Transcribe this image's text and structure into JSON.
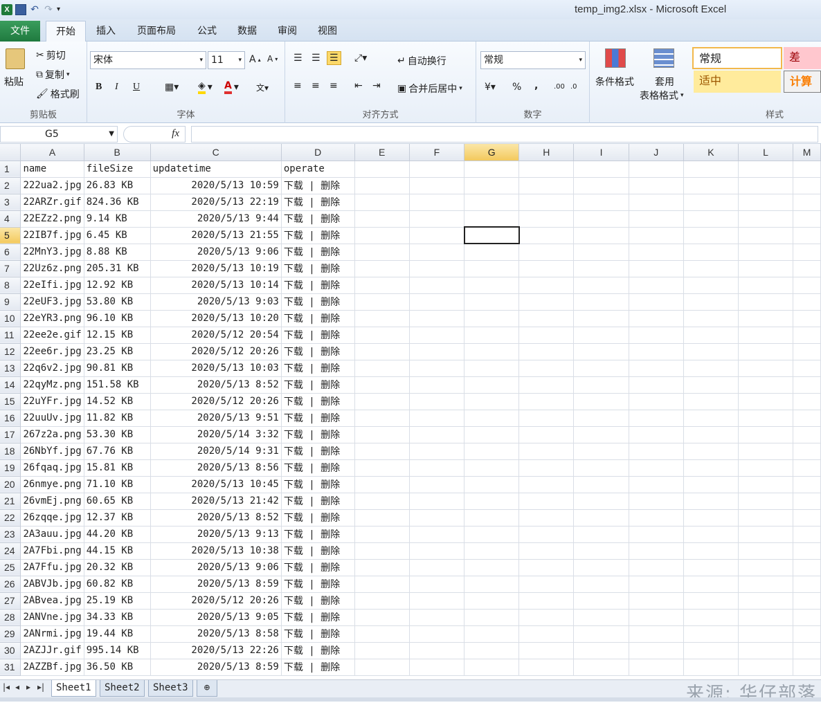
{
  "app": {
    "title": "temp_img2.xlsx - Microsoft Excel",
    "logo_letter": "X"
  },
  "tabs": [
    "文件",
    "开始",
    "插入",
    "页面布局",
    "公式",
    "数据",
    "审阅",
    "视图"
  ],
  "ribbon": {
    "clipboard": {
      "paste": "粘贴",
      "cut": "剪切",
      "copy": "复制",
      "format_painter": "格式刷",
      "label": "剪贴板"
    },
    "font": {
      "name": "宋体",
      "size": "11",
      "label": "字体",
      "bold": "B",
      "italic": "I",
      "underline": "U"
    },
    "alignment": {
      "wrap": "自动换行",
      "merge": "合并后居中",
      "label": "对齐方式"
    },
    "number": {
      "format": "常规",
      "percent": "%",
      "comma": ",",
      "label": "数字"
    },
    "styles": {
      "conditional": "条件格式",
      "table_format_1": "套用",
      "table_format_2": "表格格式",
      "normal": "常规",
      "bad": "差",
      "neutral": "适中",
      "calc": "计算",
      "label": "样式"
    }
  },
  "formula_bar": {
    "cell_ref": "G5",
    "fx": "fx",
    "value": ""
  },
  "columns": [
    "A",
    "B",
    "C",
    "D",
    "E",
    "F",
    "G",
    "H",
    "I",
    "J",
    "K",
    "L"
  ],
  "selected": {
    "col": "G",
    "row": "5"
  },
  "rows": [
    [
      "1",
      "name",
      "fileSize",
      "updatetime",
      "operate"
    ],
    [
      "2",
      "222ua2.jpg",
      "26.83 KB",
      "2020/5/13 10:59",
      "下载 | 删除"
    ],
    [
      "3",
      "22ARZr.gif",
      "824.36 KB",
      "2020/5/13 22:19",
      "下载 | 删除"
    ],
    [
      "4",
      "22EZz2.png",
      "9.14 KB",
      "2020/5/13 9:44",
      "下载 | 删除"
    ],
    [
      "5",
      "22IB7f.jpg",
      "6.45 KB",
      "2020/5/13 21:55",
      "下载 | 删除"
    ],
    [
      "6",
      "22MnY3.jpg",
      "8.88 KB",
      "2020/5/13 9:06",
      "下载 | 删除"
    ],
    [
      "7",
      "22Uz6z.png",
      "205.31 KB",
      "2020/5/13 10:19",
      "下载 | 删除"
    ],
    [
      "8",
      "22eIfi.jpg",
      "12.92 KB",
      "2020/5/13 10:14",
      "下载 | 删除"
    ],
    [
      "9",
      "22eUF3.jpg",
      "53.80 KB",
      "2020/5/13 9:03",
      "下载 | 删除"
    ],
    [
      "10",
      "22eYR3.png",
      "96.10 KB",
      "2020/5/13 10:20",
      "下载 | 删除"
    ],
    [
      "11",
      "22ee2e.gif",
      "12.15 KB",
      "2020/5/12 20:54",
      "下载 | 删除"
    ],
    [
      "12",
      "22ee6r.jpg",
      "23.25 KB",
      "2020/5/12 20:26",
      "下载 | 删除"
    ],
    [
      "13",
      "22q6v2.jpg",
      "90.81 KB",
      "2020/5/13 10:03",
      "下载 | 删除"
    ],
    [
      "14",
      "22qyMz.png",
      "151.58 KB",
      "2020/5/13 8:52",
      "下载 | 删除"
    ],
    [
      "15",
      "22uYFr.jpg",
      "14.52 KB",
      "2020/5/12 20:26",
      "下载 | 删除"
    ],
    [
      "16",
      "22uuUv.jpg",
      "11.82 KB",
      "2020/5/13 9:51",
      "下载 | 删除"
    ],
    [
      "17",
      "267z2a.png",
      "53.30 KB",
      "2020/5/14 3:32",
      "下载 | 删除"
    ],
    [
      "18",
      "26NbYf.jpg",
      "67.76 KB",
      "2020/5/14 9:31",
      "下载 | 删除"
    ],
    [
      "19",
      "26fqaq.jpg",
      "15.81 KB",
      "2020/5/13 8:56",
      "下载 | 删除"
    ],
    [
      "20",
      "26nmye.png",
      "71.10 KB",
      "2020/5/13 10:45",
      "下载 | 删除"
    ],
    [
      "21",
      "26vmEj.png",
      "60.65 KB",
      "2020/5/13 21:42",
      "下载 | 删除"
    ],
    [
      "22",
      "26zqqe.jpg",
      "12.37 KB",
      "2020/5/13 8:52",
      "下载 | 删除"
    ],
    [
      "23",
      "2A3auu.jpg",
      "44.20 KB",
      "2020/5/13 9:13",
      "下载 | 删除"
    ],
    [
      "24",
      "2A7Fbi.png",
      "44.15 KB",
      "2020/5/13 10:38",
      "下载 | 删除"
    ],
    [
      "25",
      "2A7Ffu.jpg",
      "20.32 KB",
      "2020/5/13 9:06",
      "下载 | 删除"
    ],
    [
      "26",
      "2ABVJb.jpg",
      "60.82 KB",
      "2020/5/13 8:59",
      "下载 | 删除"
    ],
    [
      "27",
      "2ABvea.jpg",
      "25.19 KB",
      "2020/5/12 20:26",
      "下载 | 删除"
    ],
    [
      "28",
      "2ANVne.jpg",
      "34.33 KB",
      "2020/5/13 9:05",
      "下载 | 删除"
    ],
    [
      "29",
      "2ANrmi.jpg",
      "19.44 KB",
      "2020/5/13 8:58",
      "下载 | 删除"
    ],
    [
      "30",
      "2AZJJr.gif",
      "995.14 KB",
      "2020/5/13 22:26",
      "下载 | 删除"
    ],
    [
      "31",
      "2AZZBf.jpg",
      "36.50 KB",
      "2020/5/13 8:59",
      "下载 | 删除"
    ]
  ],
  "sheets": [
    "Sheet1",
    "Sheet2",
    "Sheet3"
  ],
  "active_sheet": "Sheet1",
  "watermark": "来源: 华仔部落",
  "colors": {
    "accent_green": "#1f7a3f",
    "selection_header": "#f3c95d",
    "bad_bg": "#ffc7ce",
    "neutral_bg": "#ffeb9c",
    "calc_color": "#fa7d00"
  }
}
